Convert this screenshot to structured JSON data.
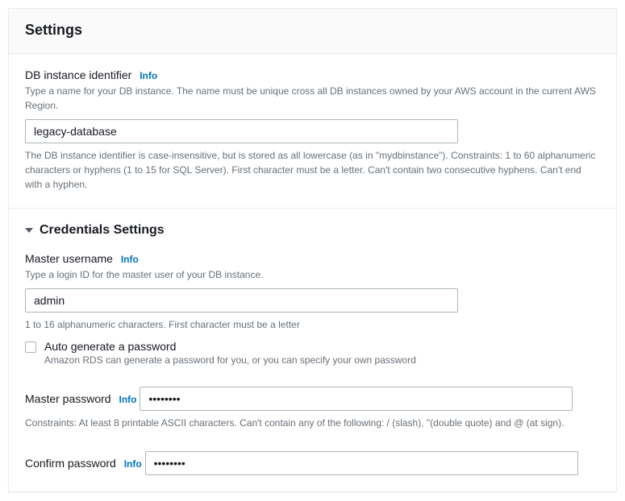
{
  "panel": {
    "title": "Settings"
  },
  "dbIdentifier": {
    "label": "DB instance identifier",
    "infoLabel": "Info",
    "helper": "Type a name for your DB instance. The name must be unique cross all DB instances owned by your AWS account in the current AWS Region.",
    "value": "legacy-database",
    "constraint": "The DB instance identifier is case-insensitive, but is stored as all lowercase (as in \"mydbinstance\"). Constraints: 1 to 60 alphanumeric characters or hyphens (1 to 15 for SQL Server). First character must be a letter. Can't contain two consecutive hyphens. Can't end with a hyphen."
  },
  "credentials": {
    "sectionTitle": "Credentials Settings",
    "masterUsername": {
      "label": "Master username",
      "infoLabel": "Info",
      "helper": "Type a login ID for the master user of your DB instance.",
      "value": "admin",
      "constraint": "1 to 16 alphanumeric characters. First character must be a letter"
    },
    "autoGenerate": {
      "label": "Auto generate a password",
      "description": "Amazon RDS can generate a password for you, or you can specify your own password"
    },
    "masterPassword": {
      "label": "Master password",
      "infoLabel": "Info",
      "value": "••••••••",
      "constraint": "Constraints: At least 8 printable ASCII characters. Can't contain any of the following: / (slash), \"(double quote) and @ (at sign)."
    },
    "confirmPassword": {
      "label": "Confirm password",
      "infoLabel": "Info",
      "value": "••••••••"
    }
  }
}
